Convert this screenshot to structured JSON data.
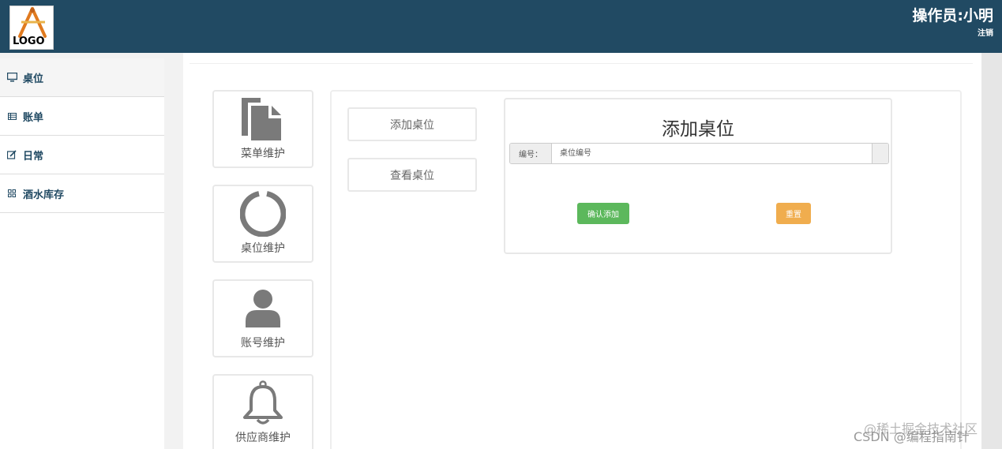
{
  "header": {
    "logo_text": "LOGO",
    "operator": "操作员:小明",
    "logout": "注销",
    "bg_color": "#214a63"
  },
  "sidebar": {
    "items": [
      {
        "label": "桌位",
        "icon": "monitor-icon"
      },
      {
        "label": "账单",
        "icon": "list-icon"
      },
      {
        "label": "日常",
        "icon": "edit-icon"
      },
      {
        "label": "酒水库存",
        "icon": "grid-icon"
      }
    ]
  },
  "tiles": [
    {
      "label": "菜单维护",
      "icon": "document-icon"
    },
    {
      "label": "桌位维护",
      "icon": "circle-icon"
    },
    {
      "label": "账号维护",
      "icon": "user-icon"
    },
    {
      "label": "供应商维护",
      "icon": "bell-icon"
    }
  ],
  "actions": {
    "add_label": "添加桌位",
    "view_label": "查看桌位"
  },
  "form": {
    "title": "添加桌位",
    "number_label": "编号：",
    "number_placeholder": "桌位编号",
    "confirm_label": "确认添加",
    "reset_label": "重置",
    "confirm_color": "#5cb85c",
    "reset_color": "#f0ad4e"
  },
  "watermark": {
    "line1": "@稀土掘金技术社区",
    "line2": "CSDN @编程指南针"
  }
}
